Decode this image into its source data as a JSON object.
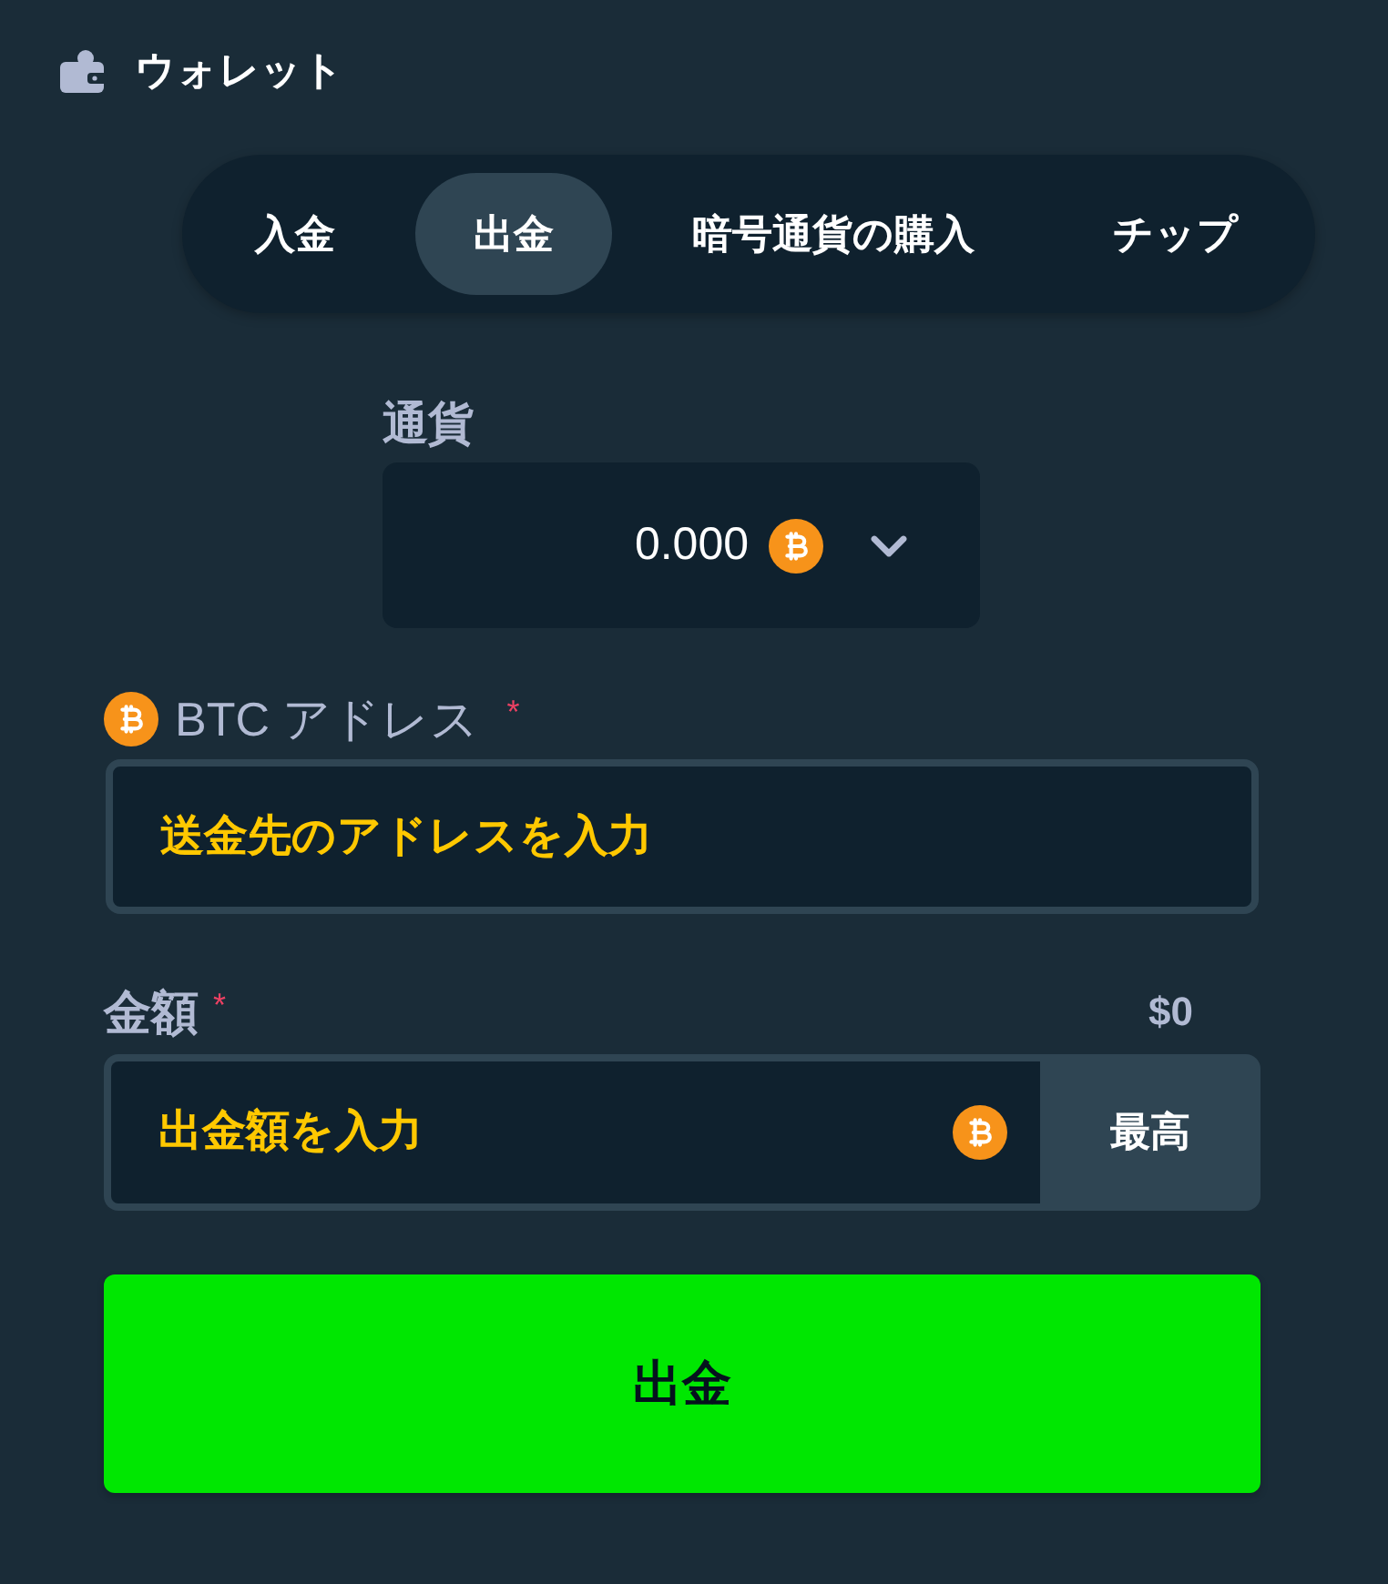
{
  "header": {
    "title": "ウォレット"
  },
  "tabs": [
    {
      "label": "入金",
      "selected": false
    },
    {
      "label": "出金",
      "selected": true
    },
    {
      "label": "暗号通貨の購入",
      "selected": false
    },
    {
      "label": "チップ",
      "selected": false
    }
  ],
  "currency": {
    "label": "通貨",
    "value": "0.000"
  },
  "address": {
    "label": "BTC アドレス",
    "required_mark": "*",
    "placeholder": "送金先のアドレスを入力"
  },
  "amount": {
    "label": "金額",
    "required_mark": "*",
    "usd_value": "$0",
    "placeholder": "出金額を入力",
    "max_button": "最高"
  },
  "submit_button": "出金"
}
